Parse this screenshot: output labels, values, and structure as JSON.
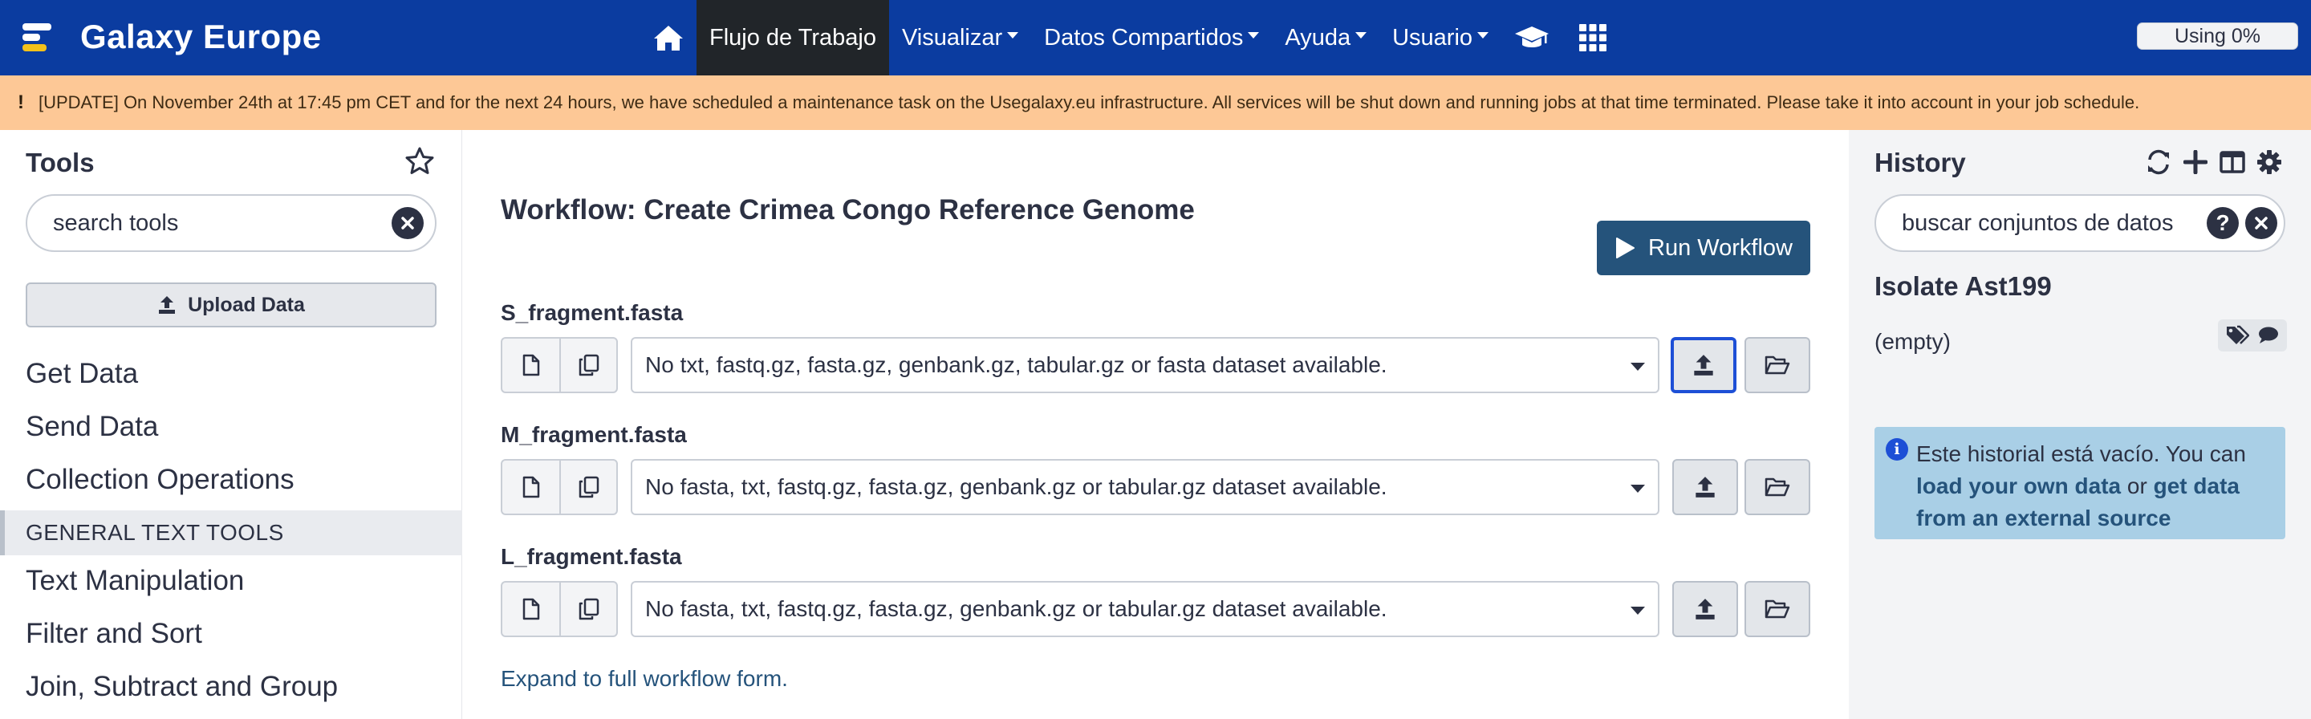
{
  "brand": {
    "title": "Galaxy Europe"
  },
  "nav": {
    "workflow": "Flujo de Trabajo",
    "visualize": "Visualizar",
    "shared": "Datos Compartidos",
    "help": "Ayuda",
    "user": "Usuario",
    "quota": "Using 0%"
  },
  "alert": {
    "text": "[UPDATE] On November 24th at 17:45 pm CET and for the next 24 hours, we have scheduled a maintenance task on the Usegalaxy.eu infrastructure. All services will be shut down and running jobs at that time terminated. Please take it into account in your job schedule."
  },
  "tools": {
    "title": "Tools",
    "search_placeholder": "search tools",
    "upload_label": "Upload Data",
    "sections": [
      "Get Data",
      "Send Data",
      "Collection Operations"
    ],
    "label_section": "GENERAL TEXT TOOLS",
    "subsections": [
      "Text Manipulation",
      "Filter and Sort",
      "Join, Subtract and Group"
    ]
  },
  "workflow": {
    "title": "Workflow: Create Crimea Congo Reference Genome",
    "run_label": "Run Workflow",
    "inputs": [
      {
        "label": "S_fragment.fasta",
        "value": "No txt, fastq.gz, fasta.gz, genbank.gz, tabular.gz or fasta dataset available."
      },
      {
        "label": "M_fragment.fasta",
        "value": "No fasta, txt, fastq.gz, fasta.gz, genbank.gz or tabular.gz dataset available."
      },
      {
        "label": "L_fragment.fasta",
        "value": "No fasta, txt, fastq.gz, fasta.gz, genbank.gz or tabular.gz dataset available."
      }
    ],
    "expand_link": "Expand to full workflow form."
  },
  "history": {
    "title": "History",
    "search_placeholder": "buscar conjuntos de datos",
    "help_glyph": "?",
    "name": "Isolate Ast199",
    "size": "(empty)",
    "info_text": "Este historial está vacío. You can",
    "info_link1": "load your own data",
    "info_or": "or",
    "info_link2": "get data from an external source",
    "info_icon": "i"
  },
  "colors": {
    "navbar": "#0b3ca0",
    "alert": "#fdc896",
    "run_button": "#25537b",
    "info_box": "#a9cfe6",
    "focus": "#1d4fd6"
  },
  "icons": {
    "brand": "galaxy-logo-icon",
    "home": "home-icon",
    "training": "graduation-cap-icon",
    "apps": "grid-icon",
    "favorites": "star-icon",
    "upload": "upload-icon",
    "run": "play-icon",
    "file": "file-icon",
    "copy": "copy-icon",
    "browse": "folder-open-icon",
    "switch": "exchange-icon",
    "new": "plus-icon",
    "columns": "columns-icon",
    "options": "gear-icon",
    "tags": "tags-icon",
    "comment": "comment-icon"
  }
}
